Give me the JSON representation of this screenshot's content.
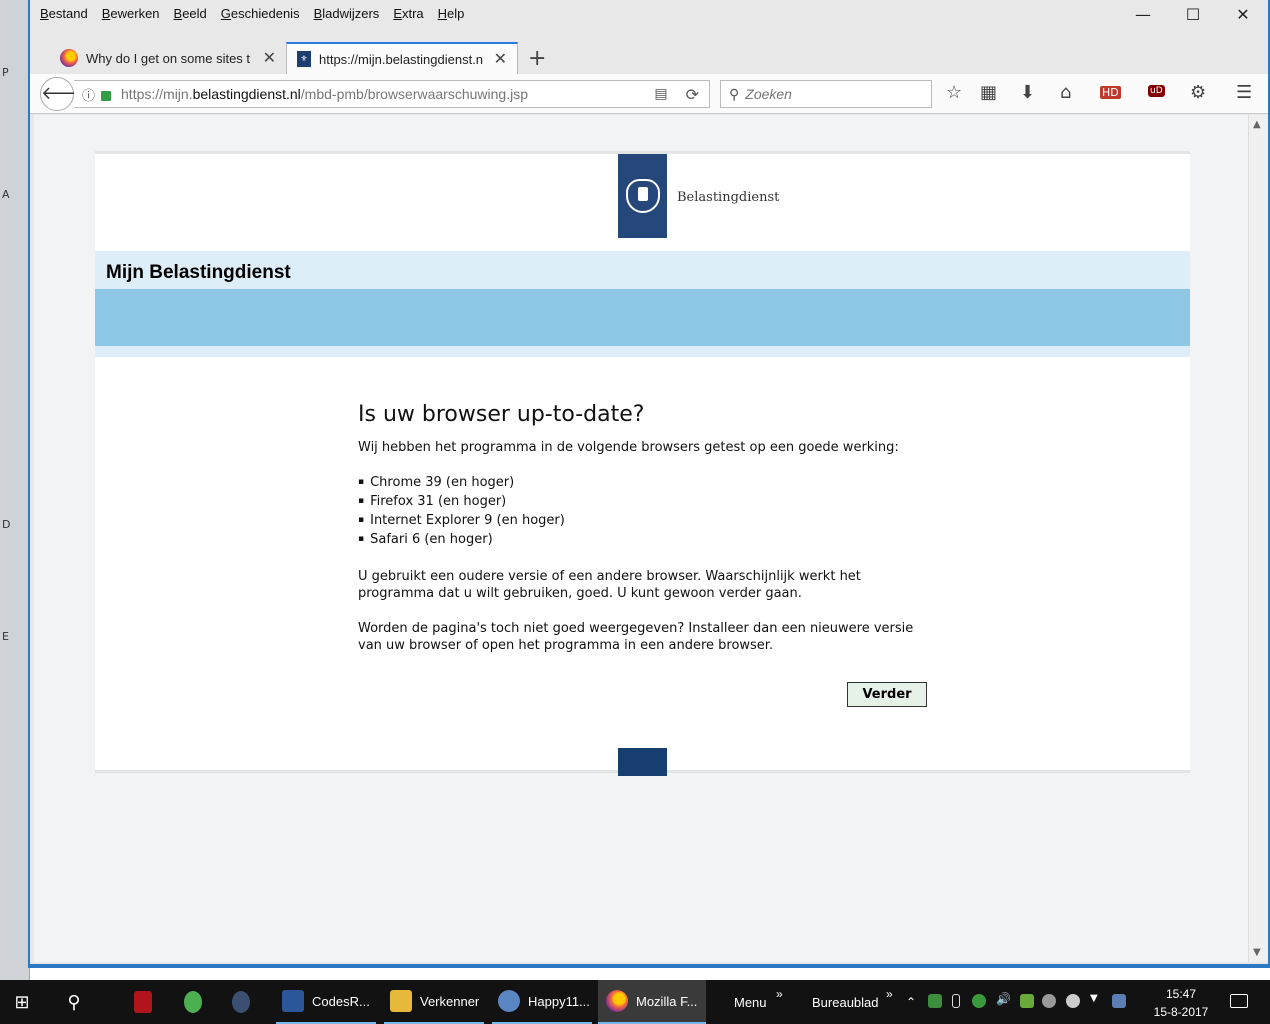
{
  "desktop": {
    "fragments": [
      "P",
      "A",
      "D",
      "E"
    ]
  },
  "window": {
    "menu": [
      "Bestand",
      "Bewerken",
      "Beeld",
      "Geschiedenis",
      "Bladwijzers",
      "Extra",
      "Help"
    ],
    "controls": {
      "minimize": "—",
      "maximize": "☐",
      "close": "✕"
    }
  },
  "tabs": [
    {
      "title": "Why do I get on some sites t",
      "close": "✕"
    },
    {
      "title": "https://mijn.belastingdienst.n",
      "close": "✕"
    }
  ],
  "new_tab": "+",
  "navbar": {
    "url_prefix": "https://mijn.",
    "url_domain": "belastingdienst.nl",
    "url_path": "/mbd-pmb/browserwaarschuwing.jsp",
    "search_placeholder": "Zoeken",
    "hd_label": "HD",
    "ublock_label": "uD"
  },
  "page": {
    "logo_text": "Belastingdienst",
    "banner_title": "Mijn Belastingdienst",
    "heading": "Is uw browser up-to-date?",
    "intro": "Wij hebben het programma in de volgende browsers getest op een goede werking:",
    "browsers": [
      "Chrome 39 (en hoger)",
      "Firefox 31 (en hoger)",
      "Internet Explorer 9 (en hoger)",
      "Safari 6 (en hoger)"
    ],
    "para1": "U gebruikt een oudere versie of een andere browser. Waarschijnlijk werkt het programma dat u wilt gebruiken, goed. U kunt gewoon verder gaan.",
    "para2": "Worden de pagina's toch niet goed weergegeven? Installeer dan een nieuwere versie van uw browser of open het programma in een andere browser.",
    "button": "Verder"
  },
  "taskbar": {
    "items": [
      "CodesR...",
      "Verkenner",
      "Happy11...",
      "Mozilla F..."
    ],
    "menu": "Menu",
    "desktop": "Bureaublad",
    "expand": "»",
    "time": "15:47",
    "date": "15-8-2017"
  },
  "colors": {
    "accent": "#2a7ae2",
    "brand_blue": "#25477a",
    "banner_light": "#ddeef9",
    "banner_mid": "#8fc8e6"
  }
}
